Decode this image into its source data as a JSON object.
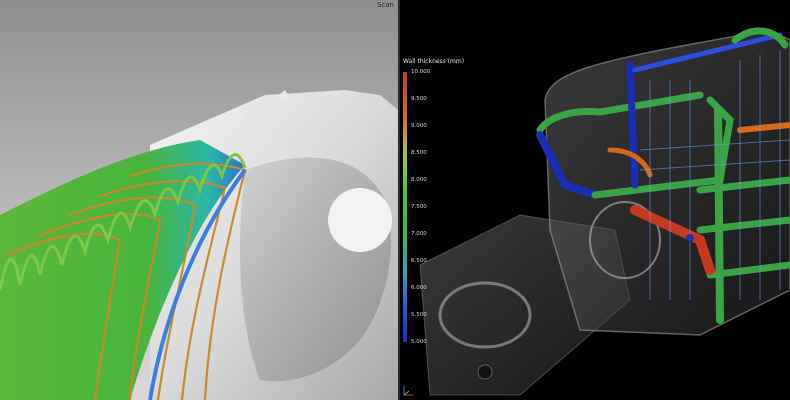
{
  "left_view": {
    "corner_label": "Scan",
    "model": "threaded-part-wall-thickness",
    "background_color": "#b4b4b4"
  },
  "right_view": {
    "legend": {
      "title": "Wall thickness (mm)",
      "ticks": [
        "10.000",
        "9.500",
        "9.000",
        "8.500",
        "8.000",
        "7.500",
        "7.000",
        "6.500",
        "6.000",
        "5.500",
        "5.000"
      ]
    },
    "background_color": "#000000"
  },
  "colors": {
    "thin": "#1a2fb8",
    "medium": "#45c244",
    "thick": "#c83a1e"
  }
}
